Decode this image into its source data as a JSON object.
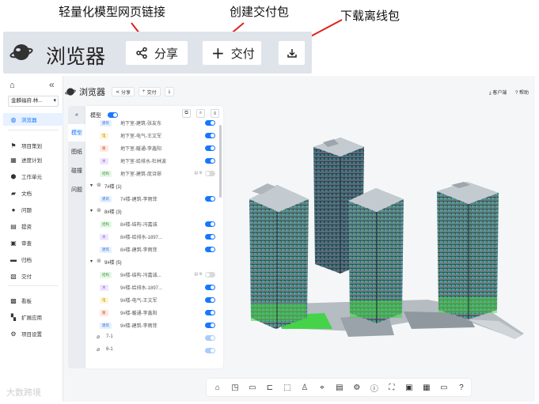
{
  "annotations": {
    "share_note": "轻量化模型网页链接",
    "deliver_note": "创建交付包",
    "download_note": "下载离线包"
  },
  "zoom_header": {
    "title": "浏览器",
    "share_label": "分享",
    "deliver_label": "交付"
  },
  "sidebar": {
    "project": "金麟福府.林...",
    "items": [
      {
        "label": "浏览器",
        "icon": "globe-icon"
      },
      {
        "label": "项目策划",
        "icon": "flag-icon"
      },
      {
        "label": "进度计划",
        "icon": "calendar-icon"
      },
      {
        "label": "工作单元",
        "icon": "cube-icon"
      },
      {
        "label": "文档",
        "icon": "folder-icon"
      },
      {
        "label": "问题",
        "icon": "question-icon"
      },
      {
        "label": "提资",
        "icon": "file-icon"
      },
      {
        "label": "审查",
        "icon": "review-icon"
      },
      {
        "label": "归档",
        "icon": "archive-icon"
      },
      {
        "label": "交付",
        "icon": "package-icon"
      },
      {
        "label": "看板",
        "icon": "dashboard-icon"
      },
      {
        "label": "扩展应用",
        "icon": "apps-icon"
      },
      {
        "label": "项目设置",
        "icon": "gear-icon"
      }
    ]
  },
  "header": {
    "title": "浏览器",
    "share_label": "分享",
    "deliver_label": "交付",
    "client_label": "客户端",
    "help_label": "帮助"
  },
  "tabs": [
    "模型",
    "图纸",
    "碰撞",
    "问题"
  ],
  "panel": {
    "label": "模型",
    "rows": [
      {
        "kind": "item",
        "badge": "建筑",
        "text": "地下室-建筑-张友东",
        "on": true
      },
      {
        "kind": "item",
        "badge": "电",
        "text": "地下室-电气-王文军",
        "on": true
      },
      {
        "kind": "item",
        "badge": "暖",
        "text": "地下室-暖通-李鑫阳",
        "on": true
      },
      {
        "kind": "item",
        "badge": "水",
        "text": "地下室-给排水-杜林波",
        "on": true
      },
      {
        "kind": "item",
        "badge": "结构",
        "text": "地下室-建筑-庞诗璟",
        "on": false
      },
      {
        "kind": "group",
        "text": "7#楼 (1)"
      },
      {
        "kind": "item",
        "badge": "建筑",
        "text": "7#楼-建筑-李雨菲",
        "on": true
      },
      {
        "kind": "group",
        "text": "8#楼 (3)"
      },
      {
        "kind": "item",
        "badge": "结构",
        "text": "8#楼-结构-冯嘉诚",
        "on": true
      },
      {
        "kind": "item",
        "badge": "水",
        "text": "8#楼-给排水-1897...",
        "on": true
      },
      {
        "kind": "item",
        "badge": "建筑",
        "text": "8#楼-建筑-李雨菲",
        "on": true
      },
      {
        "kind": "group",
        "text": "9#楼 (5)"
      },
      {
        "kind": "item",
        "badge": "结构",
        "text": "9#楼-结构-冯嘉诚...",
        "on": false
      },
      {
        "kind": "item",
        "badge": "水",
        "text": "9#楼-给排水-1897...",
        "on": true
      },
      {
        "kind": "item",
        "badge": "电",
        "text": "9#楼-电气-王文军",
        "on": true
      },
      {
        "kind": "item",
        "badge": "暖",
        "text": "9#楼-暖通-李鑫阳",
        "on": true
      },
      {
        "kind": "item",
        "badge": "建筑",
        "text": "9#楼-建筑-李雨菲",
        "on": true
      },
      {
        "kind": "link",
        "text": "7-1",
        "on": true
      },
      {
        "kind": "link",
        "text": "6-1",
        "on": true
      }
    ]
  },
  "badge_colors": {
    "建筑": [
      "#e6f0ff",
      "#3a74d6"
    ],
    "结构": [
      "#e7f7e7",
      "#3b9a3b"
    ],
    "电": [
      "#fff6d6",
      "#b88900"
    ],
    "暖": [
      "#ffe8e0",
      "#d05a2a"
    ],
    "水": [
      "#efe6ff",
      "#7a54c8"
    ]
  },
  "watermark": "大数跨境",
  "accent": "#1677ff"
}
